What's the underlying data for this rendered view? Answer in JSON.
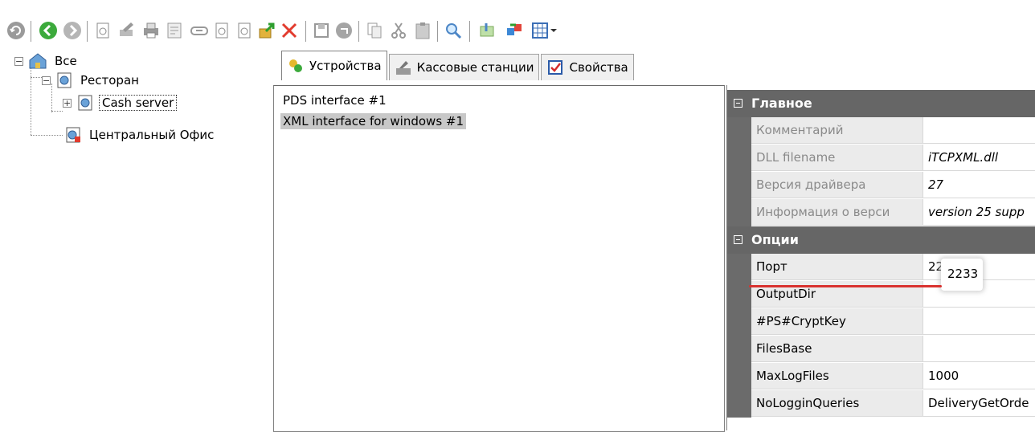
{
  "toolbar": {
    "buttons": [
      "refresh-icon",
      "back-icon",
      "forward-icon",
      "new-item-icon",
      "edit-icon",
      "print-icon",
      "print-preview-icon",
      "link-icon",
      "copy-item-icon",
      "paste-item-icon",
      "export-icon",
      "delete-icon",
      "save-icon",
      "undo-icon",
      "copy-icon",
      "cut-icon",
      "paste-icon",
      "search-icon",
      "import-icon",
      "transfer-icon",
      "grid-view-icon"
    ]
  },
  "tree": {
    "root": "Все",
    "restaurant": "Ресторан",
    "cash_server": "Cash server",
    "central_office": "Центральный Офис"
  },
  "tabs": [
    {
      "label": "Устройства",
      "active": true
    },
    {
      "label": "Кассовые станции",
      "active": false
    },
    {
      "label": "Свойства",
      "active": false
    }
  ],
  "devices": [
    {
      "label": "PDS interface #1",
      "selected": false
    },
    {
      "label": "XML interface for windows #1",
      "selected": true
    }
  ],
  "properties": {
    "main_category": "Главное",
    "main_rows": [
      {
        "name": "Комментарий",
        "value": ""
      },
      {
        "name": "DLL filename",
        "value": "iTCPXML.dll"
      },
      {
        "name": "Версия драйвера",
        "value": "27"
      },
      {
        "name": "Информация о верси",
        "value": "version 25 supp"
      }
    ],
    "options_category": "Опции",
    "options_rows": [
      {
        "name": "Порт",
        "value": "2233"
      },
      {
        "name": "OutputDir",
        "value": ""
      },
      {
        "name": "#PS#CryptKey",
        "value": ""
      },
      {
        "name": "FilesBase",
        "value": ""
      },
      {
        "name": "MaxLogFiles",
        "value": "1000"
      },
      {
        "name": "NoLogginQueries",
        "value": "DeliveryGetOrde"
      }
    ]
  },
  "colors": {
    "category_bg": "#666666",
    "selection": "#c8c8c8",
    "annotation_underline": "#d9322f"
  }
}
